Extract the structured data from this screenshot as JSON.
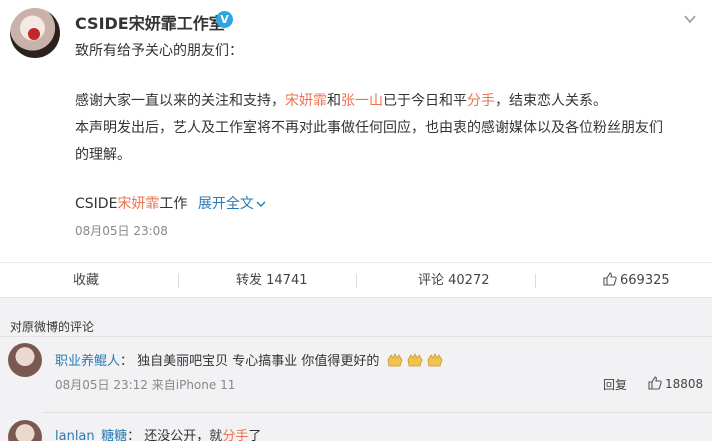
{
  "post": {
    "author": "CSIDE宋妍霏工作室",
    "greeting": "致所有给予关心的朋友们：",
    "para1_a": "感谢大家一直以来的关注和支持，",
    "para1_name1": "宋妍霏",
    "para1_and": "和",
    "para1_name2": "张一山",
    "para1_b": "已于今日和平",
    "para1_breakup": "分手",
    "para1_c": "，结束恋人关系。",
    "para2": "本声明发出后，艺人及工作室将不再对此事做任何回应，也由衷的感谢媒体以及各位粉丝朋友们的理解。",
    "sig_a": "CSIDE",
    "sig_name": "宋妍霏",
    "sig_b": "工作",
    "expand": "展开全文",
    "time": "08月05日 23:08"
  },
  "actions": {
    "favorite": "收藏",
    "repost": "转发 14741",
    "comment": "评论 40272",
    "likes": "669325"
  },
  "comments": {
    "title": "对原微博的评论",
    "items": [
      {
        "user": "职业养鲲人",
        "sep": "：",
        "text": "独自美丽吧宝贝 专心搞事业 你值得更好的",
        "meta": "08月05日 23:12 来自iPhone 11",
        "reply": "回复",
        "likes": "18808"
      },
      {
        "user": "lanlan_糖糖",
        "sep": "：",
        "text_a": "还没公开，就",
        "text_red": "分手",
        "text_b": "了"
      }
    ]
  },
  "colors": {
    "highlight": "#eb7350",
    "link": "#2a7ab0",
    "verified": "#2ea7e0",
    "comment_bg": "#f2f2f5"
  },
  "icons": [
    "verified-icon",
    "chevron-down-icon",
    "thumb-up-icon",
    "clap-emoji-icon"
  ]
}
